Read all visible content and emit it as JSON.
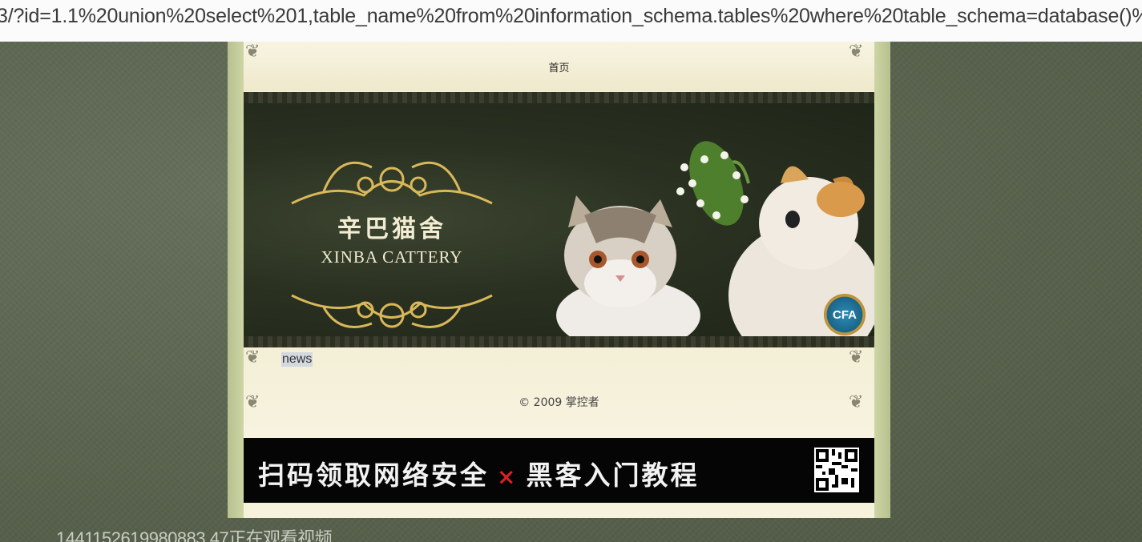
{
  "browser": {
    "url_visible": "3/?id=1.1%20union%20select%201,table_name%20from%20information_schema.tables%20where%20table_schema=database()%"
  },
  "site": {
    "nav": {
      "home_label": "首页"
    },
    "banner": {
      "logo_cn": "辛巴猫舍",
      "logo_en": "XINBA CATTERY",
      "badge_text": "CFA"
    },
    "news": {
      "label": "news"
    },
    "footer": {
      "copyright": "© 2009 掌控者"
    }
  },
  "ad": {
    "text_left": "扫码领取网络安全",
    "cross": "×",
    "text_right": "黑客入门教程",
    "qr_icon": "qr-code-icon"
  },
  "overlay": {
    "viewer_count_text": "1441152619980883 47正在观看视频"
  },
  "colors": {
    "desktop_bg": "#5a6450",
    "page_bg": "#f6f2dc",
    "frame_green": "#b7c08f",
    "ad_bg": "#050505",
    "ad_cross": "#e02020"
  }
}
